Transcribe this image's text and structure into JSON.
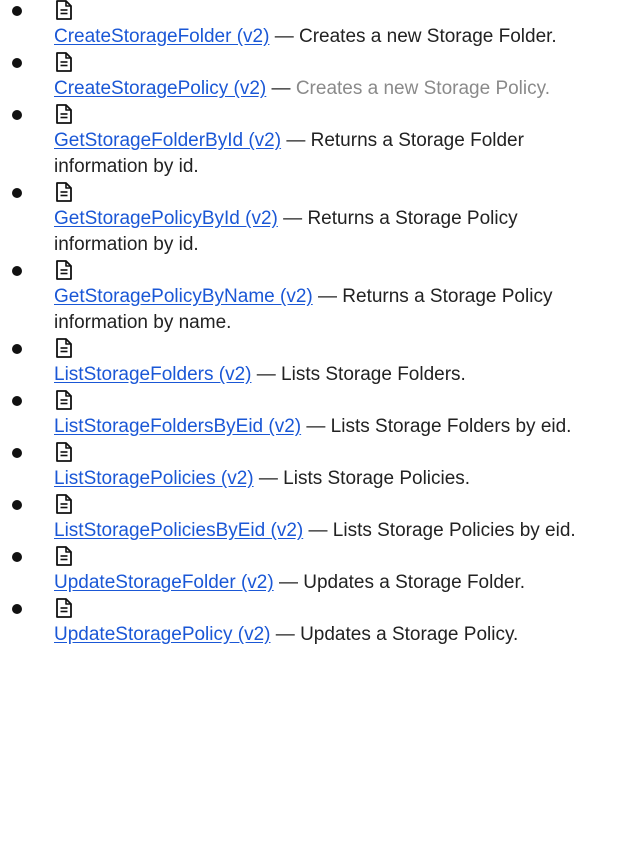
{
  "items": [
    {
      "link": "CreateStorageFolder (v2)",
      "separator": " — ",
      "description": "Creates a new Storage Folder."
    },
    {
      "link": "CreateStoragePolicy (v2)",
      "separator": " — ",
      "description": "Creates a new Storage Policy."
    },
    {
      "link": "GetStorageFolderById (v2)",
      "separator": " — ",
      "description": "Returns a Storage Folder information by id."
    },
    {
      "link": "GetStoragePolicyById (v2)",
      "separator": " — ",
      "description": "Returns a Storage Policy information by id."
    },
    {
      "link": "GetStoragePolicyByName (v2)",
      "separator": " — ",
      "description": "Returns a Storage Policy information by name."
    },
    {
      "link": "ListStorageFolders (v2)",
      "separator": " — ",
      "description": "Lists Storage Folders."
    },
    {
      "link": "ListStorageFoldersByEid (v2)",
      "separator": " — ",
      "description": "Lists Storage Folders by eid."
    },
    {
      "link": "ListStoragePolicies (v2)",
      "separator": " — ",
      "description": "Lists Storage Policies."
    },
    {
      "link": "ListStoragePoliciesByEid (v2)",
      "separator": " — ",
      "description": "Lists Storage Policies by eid."
    },
    {
      "link": "UpdateStorageFolder (v2)",
      "separator": " — ",
      "description": "Updates a Storage Folder."
    },
    {
      "link": "UpdateStoragePolicy (v2)",
      "separator": " — ",
      "description": "Updates a Storage Policy."
    }
  ],
  "icon": "document-icon",
  "colors": {
    "link": "#1a57d6",
    "text": "#222222",
    "muted_text": "#8a8a8a"
  }
}
